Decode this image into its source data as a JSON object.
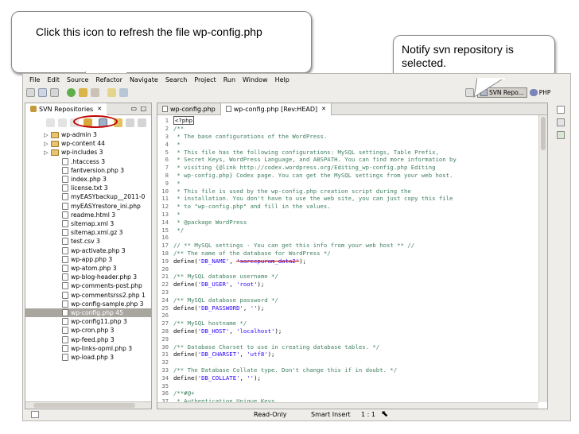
{
  "callouts": {
    "refresh": "Click this icon to refresh the file wp-config.php",
    "notify": "Notify svn repository is selected."
  },
  "menu": [
    "File",
    "Edit",
    "Source",
    "Refactor",
    "Navigate",
    "Search",
    "Project",
    "Run",
    "Window",
    "Help"
  ],
  "perspective": {
    "svn_label": "SVN Repo...",
    "php_label": "PHP"
  },
  "left_panel": {
    "tab_label": "SVN Repositories",
    "items": [
      {
        "label": "wp-admin 3",
        "type": "folder"
      },
      {
        "label": "wp-content 44",
        "type": "folder"
      },
      {
        "label": "wp-includes 3",
        "type": "folder"
      },
      {
        "label": ".htaccess 3",
        "type": "file"
      },
      {
        "label": "fantversion.php 3",
        "type": "file"
      },
      {
        "label": "index.php 3",
        "type": "file"
      },
      {
        "label": "license.txt 3",
        "type": "file"
      },
      {
        "label": "myEASYbackup__2011-0",
        "type": "file"
      },
      {
        "label": "myEASYrestore_ini.php",
        "type": "file"
      },
      {
        "label": "readme.html 3",
        "type": "file"
      },
      {
        "label": "sitemap.xml 3",
        "type": "file"
      },
      {
        "label": "sitemap.xml.gz 3",
        "type": "file"
      },
      {
        "label": "test.csv 3",
        "type": "file"
      },
      {
        "label": "wp-activate.php 3",
        "type": "file"
      },
      {
        "label": "wp-app.php 3",
        "type": "file"
      },
      {
        "label": "wp-atom.php 3",
        "type": "file"
      },
      {
        "label": "wp-blog-header.php 3",
        "type": "file"
      },
      {
        "label": "wp-comments-post.php",
        "type": "file"
      },
      {
        "label": "wp-commentsrss2.php 1",
        "type": "file"
      },
      {
        "label": "wp-config-sample.php 3",
        "type": "file"
      },
      {
        "label": "wp-config.php 45",
        "type": "file",
        "selected": true
      },
      {
        "label": "wp-config11.php 3",
        "type": "file"
      },
      {
        "label": "wp-cron.php 3",
        "type": "file"
      },
      {
        "label": "wp-feed.php 3",
        "type": "file"
      },
      {
        "label": "wp-links-opml.php 3",
        "type": "file"
      },
      {
        "label": "wp-load.php 3",
        "type": "file"
      }
    ]
  },
  "editor": {
    "tabs": [
      "wp-config.php",
      "wp-config.php [Rev:HEAD]"
    ],
    "lines": [
      {
        "n": "1",
        "t": "<?php"
      },
      {
        "n": "2",
        "t": "/**"
      },
      {
        "n": "3",
        "t": " * The base configurations of the WordPress."
      },
      {
        "n": "4",
        "t": " *"
      },
      {
        "n": "5",
        "t": " * This file has the following configurations: MySQL settings, Table Prefix,"
      },
      {
        "n": "6",
        "t": " * Secret Keys, WordPress Language, and ABSPATH. You can find more information by"
      },
      {
        "n": "7",
        "t": " * visiting {@link http://codex.wordpress.org/Editing_wp-config.php Editing"
      },
      {
        "n": "8",
        "t": " * wp-config.php} Codex page. You can get the MySQL settings from your web host."
      },
      {
        "n": "9",
        "t": " *"
      },
      {
        "n": "10",
        "t": " * This file is used by the wp-config.php creation script during the"
      },
      {
        "n": "11",
        "t": " * installation. You don't have to use the web site, you can just copy this file"
      },
      {
        "n": "12",
        "t": " * to \"wp-config.php\" and fill in the values."
      },
      {
        "n": "13",
        "t": " *"
      },
      {
        "n": "14",
        "t": " * @package WordPress"
      },
      {
        "n": "15",
        "t": " */"
      },
      {
        "n": "16",
        "t": ""
      },
      {
        "n": "17",
        "t": "// ** MySQL settings - You can get this info from your web host ** //"
      },
      {
        "n": "18",
        "t": "/** The name of the database for WordPress */"
      },
      {
        "n": "19",
        "t": "define('DB_NAME', 'sareepuram_data2');"
      },
      {
        "n": "20",
        "t": ""
      },
      {
        "n": "21",
        "t": "/** MySQL database username */"
      },
      {
        "n": "22",
        "t": "define('DB_USER', 'root');"
      },
      {
        "n": "23",
        "t": ""
      },
      {
        "n": "24",
        "t": "/** MySQL database password */"
      },
      {
        "n": "25",
        "t": "define('DB_PASSWORD', '');"
      },
      {
        "n": "26",
        "t": ""
      },
      {
        "n": "27",
        "t": "/** MySQL hostname */"
      },
      {
        "n": "28",
        "t": "define('DB_HOST', 'localhost');"
      },
      {
        "n": "29",
        "t": ""
      },
      {
        "n": "30",
        "t": "/** Database Charset to use in creating database tables. */"
      },
      {
        "n": "31",
        "t": "define('DB_CHARSET', 'utf8');"
      },
      {
        "n": "32",
        "t": ""
      },
      {
        "n": "33",
        "t": "/** The Database Collate type. Don't change this if in doubt. */"
      },
      {
        "n": "34",
        "t": "define('DB_COLLATE', '');"
      },
      {
        "n": "35",
        "t": ""
      },
      {
        "n": "36",
        "t": "/**#@+"
      },
      {
        "n": "37",
        "t": " * Authentication Unique Keys."
      }
    ]
  },
  "status": {
    "mode": "Read-Only",
    "insert": "Smart Insert",
    "position": "1 : 1"
  },
  "colors": {
    "highlight": "#c00000",
    "selection": "#a9a6a0",
    "comment": "#3f7f5f",
    "string": "#2a00ff"
  }
}
